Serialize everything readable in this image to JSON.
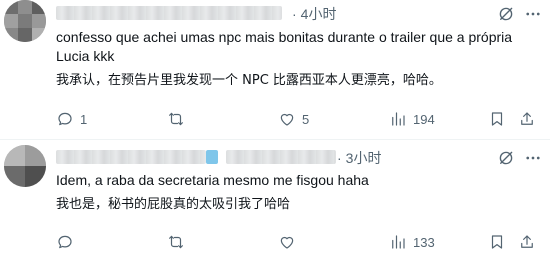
{
  "colors": {
    "text": "#0f1419",
    "secondary": "#536471",
    "divider": "#eff3f4"
  },
  "tweets": [
    {
      "time": "4小时",
      "text_original": "confesso que achei umas npc mais bonitas durante o trailer que a própria Lucia kkk",
      "text_translation": "我承认，在预告片里我发现一个 NPC 比露西亚本人更漂亮，哈哈。",
      "replies": "1",
      "reposts": "",
      "likes": "5",
      "views": "194"
    },
    {
      "time": "3小时",
      "text_original": "Idem, a raba da secretaria mesmo me fisgou haha",
      "text_translation": "我也是，秘书的屁股真的太吸引我了哈哈",
      "replies": "",
      "reposts": "",
      "likes": "",
      "views": "133"
    }
  ],
  "icons": {
    "grok": "grok-slash-icon",
    "more": "more-horizontal-icon",
    "reply": "reply-bubble-icon",
    "repost": "repost-arrows-icon",
    "like": "heart-icon",
    "views": "views-bars-icon",
    "bookmark": "bookmark-icon",
    "share": "share-upload-icon"
  }
}
